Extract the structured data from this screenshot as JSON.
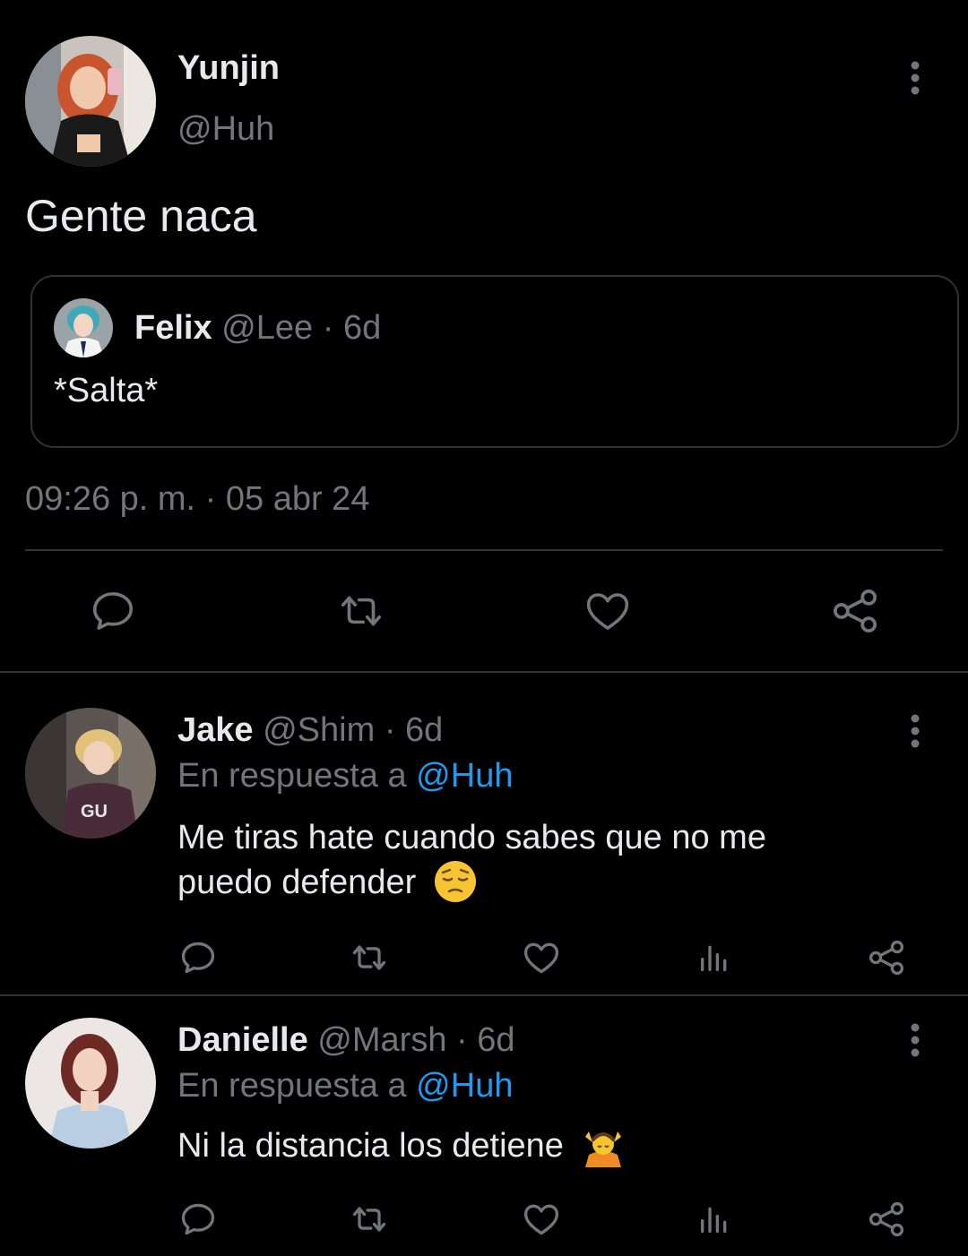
{
  "main_tweet": {
    "author_name": "Yunjin",
    "author_handle": "@Huh",
    "text": "Gente naca",
    "quote": {
      "author_name": "Felix",
      "author_handle": "@Lee",
      "time_sep": "·",
      "time": "6d",
      "text": "*Salta*"
    },
    "timestamp": "09:26 p. m. · 05 abr 24",
    "actions": [
      "reply-icon",
      "retweet-icon",
      "like-icon",
      "share-icon"
    ]
  },
  "replies": [
    {
      "author_name": "Jake",
      "author_handle": "@Shim",
      "time_sep": "·",
      "time": "6d",
      "reply_prefix": "En respuesta a",
      "reply_to": "@Huh",
      "text_line1": "Me tiras hate cuando sabes que no me",
      "text_line2": "puedo defender",
      "emoji": "pensive-face",
      "actions": [
        "reply-icon",
        "retweet-icon",
        "like-icon",
        "analytics-icon",
        "share-icon"
      ]
    },
    {
      "author_name": "Danielle",
      "author_handle": "@Marsh",
      "time_sep": "·",
      "time": "6d",
      "reply_prefix": "En respuesta a",
      "reply_to": "@Huh",
      "text_line1": "Ni la distancia los detiene",
      "emoji": "person-getting-massage",
      "actions": [
        "reply-icon",
        "retweet-icon",
        "like-icon",
        "analytics-icon",
        "share-icon"
      ]
    }
  ],
  "colors": {
    "background": "#000000",
    "text": "#e7e9ea",
    "muted": "#71767b",
    "link": "#1d9bf0",
    "divider": "#2f3336"
  }
}
